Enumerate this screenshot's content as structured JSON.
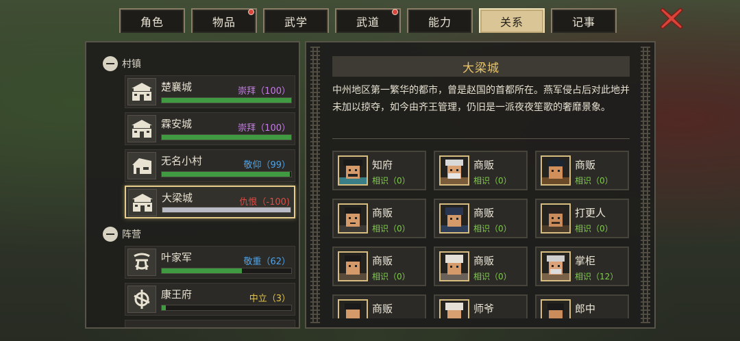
{
  "tabs": [
    {
      "label": "角色",
      "active": false,
      "dot": false
    },
    {
      "label": "物品",
      "active": false,
      "dot": true
    },
    {
      "label": "武学",
      "active": false,
      "dot": false
    },
    {
      "label": "武道",
      "active": false,
      "dot": true
    },
    {
      "label": "能力",
      "active": false,
      "dot": false
    },
    {
      "label": "关系",
      "active": true,
      "dot": false
    },
    {
      "label": "记事",
      "active": false,
      "dot": false
    }
  ],
  "close_icon": "x-close-icon",
  "sections": {
    "villages": {
      "title": "村镇",
      "items": [
        {
          "name": "楚襄城",
          "relation": "崇拜（100）",
          "color": "#c77ce8",
          "fill": 1.0,
          "bar_color": "#3f9a41",
          "icon": "city-gate-icon"
        },
        {
          "name": "霖安城",
          "relation": "崇拜（100）",
          "color": "#c77ce8",
          "fill": 1.0,
          "bar_color": "#3f9a41",
          "icon": "city-gate-icon"
        },
        {
          "name": "无名小村",
          "relation": "敬仰（99）",
          "color": "#4ea3e8",
          "fill": 0.99,
          "bar_color": "#3f9a41",
          "icon": "house-icon"
        },
        {
          "name": "大梁城",
          "relation": "仇恨（-100)",
          "color": "#e24a43",
          "fill": 1.0,
          "bar_color": "#b9bbc6",
          "icon": "city-gate-icon",
          "selected": true
        }
      ]
    },
    "factions": {
      "title": "阵营",
      "items": [
        {
          "name": "叶家军",
          "relation": "敬重（62）",
          "color": "#4ea3e8",
          "fill": 0.62,
          "bar_color": "#3f9a41",
          "icon": "army-emblem-icon"
        },
        {
          "name": "康王府",
          "relation": "中立（3）",
          "color": "#e0c24a",
          "fill": 0.03,
          "bar_color": "#3f9a41",
          "icon": "manor-emblem-icon"
        }
      ]
    }
  },
  "detail": {
    "title": "大梁城",
    "description": "中州地区第一繁华的都市，曾是赵国的首都所在。燕军侵占后对此地并未加以掠夺，如今由齐王管理，仍旧是一派夜夜笙歌的奢靡景象。",
    "npcs": [
      {
        "role": "知府",
        "relation": "相识（0）",
        "portrait": "official-portrait"
      },
      {
        "role": "商贩",
        "relation": "相识（0）",
        "portrait": "elder-merchant-portrait"
      },
      {
        "role": "商贩",
        "relation": "相识（0）",
        "portrait": "topknot-merchant-portrait"
      },
      {
        "role": "商贩",
        "relation": "相识（0）",
        "portrait": "merchant-portrait"
      },
      {
        "role": "商贩",
        "relation": "相识（0）",
        "portrait": "capped-merchant-portrait"
      },
      {
        "role": "打更人",
        "relation": "相识（0）",
        "portrait": "watchman-portrait"
      },
      {
        "role": "商贩",
        "relation": "相识（0）",
        "portrait": "merchant-portrait"
      },
      {
        "role": "商贩",
        "relation": "相识（0）",
        "portrait": "white-cap-merchant-portrait"
      },
      {
        "role": "掌柜",
        "relation": "相识（12）",
        "portrait": "shopkeeper-portrait"
      },
      {
        "role": "商贩",
        "relation": "",
        "portrait": "merchant-portrait"
      },
      {
        "role": "师爷",
        "relation": "",
        "portrait": "advisor-portrait"
      },
      {
        "role": "郎中",
        "relation": "",
        "portrait": "doctor-portrait"
      }
    ]
  }
}
